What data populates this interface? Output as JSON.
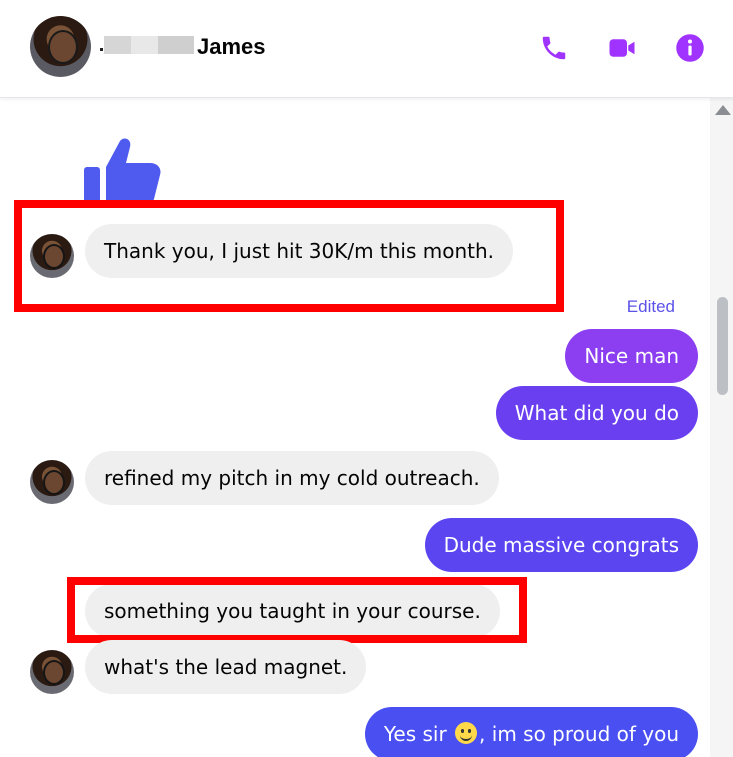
{
  "header": {
    "contact_name": "James",
    "actions": [
      {
        "icon": "phone-icon"
      },
      {
        "icon": "video-camera-icon"
      },
      {
        "icon": "info-icon"
      }
    ]
  },
  "colors": {
    "accent": "#a033ff",
    "outgoing_top": "#8b3ff0",
    "outgoing_mid": "#6a3ff0",
    "outgoing_bottom": "#4a4ff2",
    "incoming": "#efefef",
    "highlight": "#ff0000",
    "like": "#4f5bee"
  },
  "thread": {
    "edited_label": "Edited",
    "messages": [
      {
        "from": "them",
        "text": "Thank you, I just hit 30K/m this month."
      },
      {
        "from": "me",
        "text": "Nice man"
      },
      {
        "from": "me",
        "text": "What did you do"
      },
      {
        "from": "them",
        "text": "refined my pitch in my cold outreach."
      },
      {
        "from": "me",
        "text": "Dude massive congrats"
      },
      {
        "from": "them",
        "text": "something you taught in your course."
      },
      {
        "from": "them",
        "text": "what's the lead magnet."
      },
      {
        "from": "me",
        "text_before": "Yes sir",
        "emoji": "slightly-smiling-face",
        "text_after": ", im so proud of you"
      }
    ]
  }
}
